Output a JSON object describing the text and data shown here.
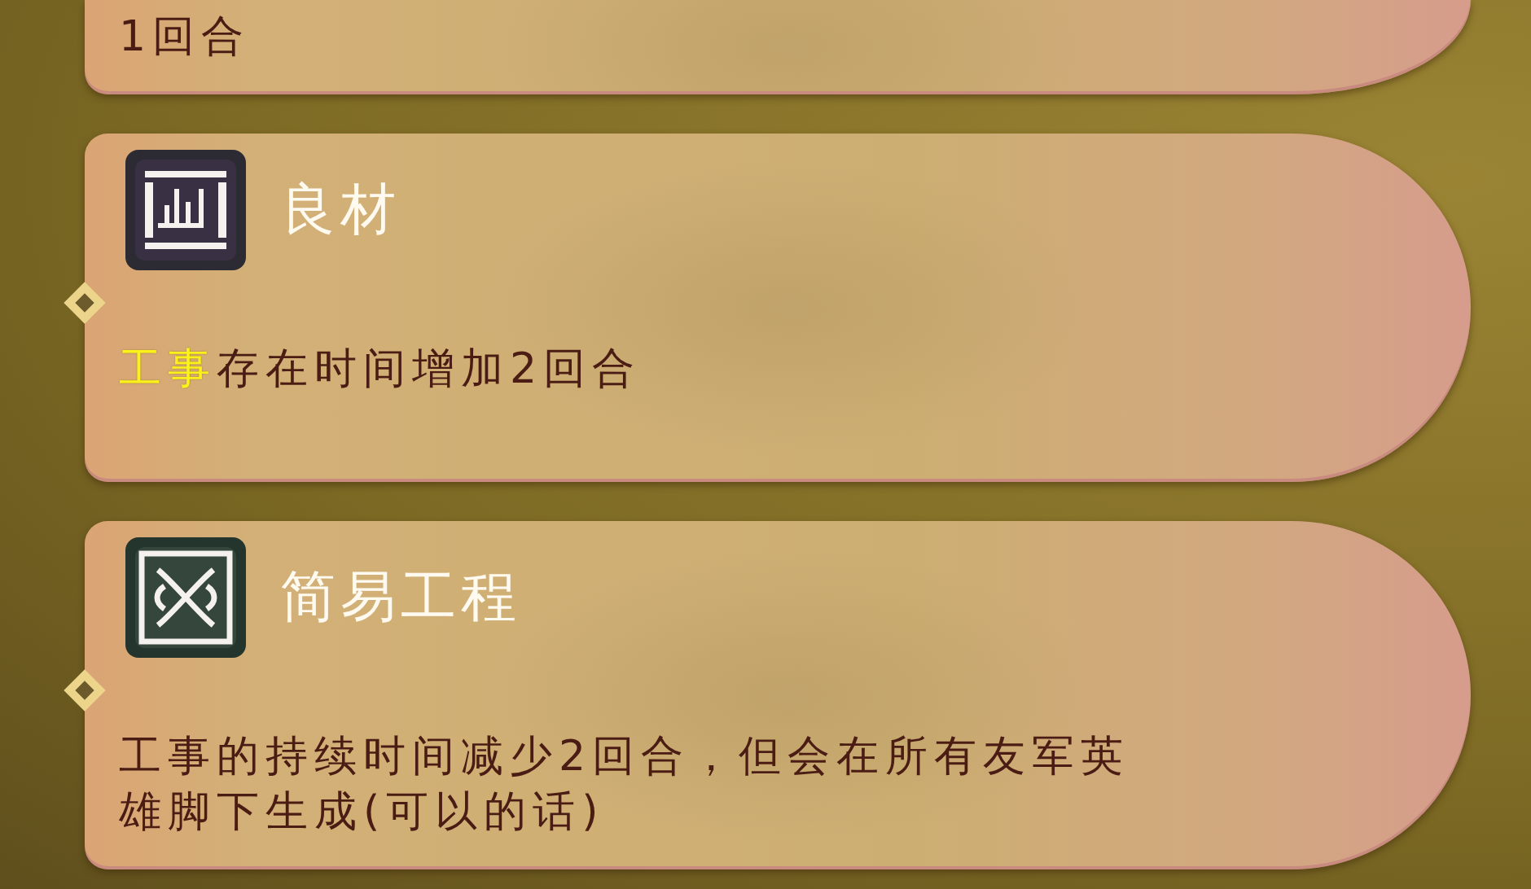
{
  "cards": [
    {
      "description": [
        {
          "text": "1回合",
          "highlight": false
        }
      ]
    },
    {
      "title": "良材",
      "description": [
        {
          "text": "工事",
          "highlight": true
        },
        {
          "text": "存在时间增加2回合",
          "highlight": false
        }
      ]
    },
    {
      "title": "简易工程",
      "description": [
        {
          "text": "工事的持续时间减少2回合，但会在所有友军英雄脚下生成(可以的话)",
          "highlight": false
        }
      ]
    }
  ]
}
